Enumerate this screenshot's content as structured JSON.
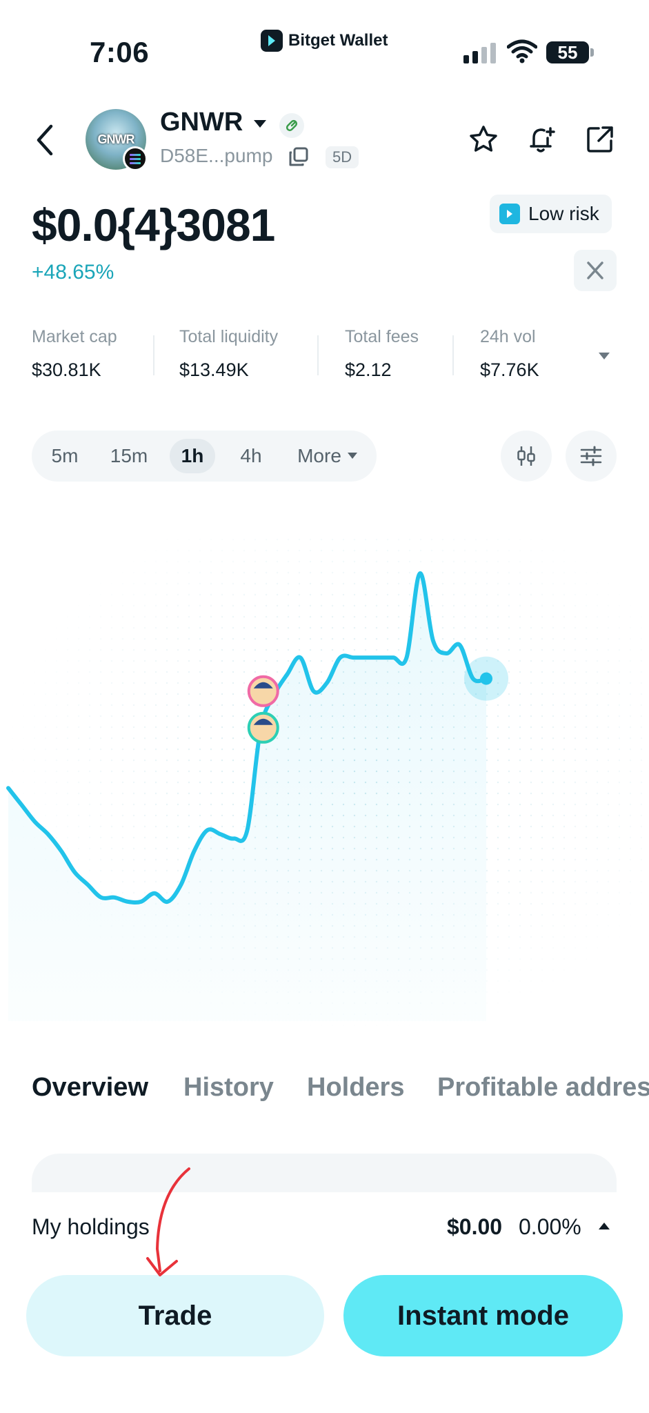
{
  "status_bar": {
    "time": "7:06",
    "battery": "55"
  },
  "brand": {
    "name": "Bitget Wallet"
  },
  "token": {
    "symbol": "GNWR",
    "avatar_text": "GNWR",
    "address": "D58E...pump",
    "age": "5D",
    "price": "$0.0{4}3081",
    "change": "+48.65%",
    "risk_label": "Low risk"
  },
  "stats": [
    {
      "label": "Market cap",
      "value": "$30.81K"
    },
    {
      "label": "Total liquidity",
      "value": "$13.49K"
    },
    {
      "label": "Total fees",
      "value": "$2.12"
    },
    {
      "label": "24h vol",
      "value": "$7.76K"
    }
  ],
  "intervals": [
    {
      "label": "5m",
      "active": false
    },
    {
      "label": "15m",
      "active": false
    },
    {
      "label": "1h",
      "active": true
    },
    {
      "label": "4h",
      "active": false
    },
    {
      "label": "More",
      "active": false
    }
  ],
  "chart_data": {
    "type": "line",
    "series": [
      {
        "values": [
          0.48,
          0.44,
          0.4,
          0.37,
          0.33,
          0.28,
          0.25,
          0.22,
          0.22,
          0.21,
          0.21,
          0.23,
          0.21,
          0.25,
          0.33,
          0.38,
          0.37,
          0.36,
          0.38,
          0.62,
          0.7,
          0.75,
          0.79,
          0.71,
          0.73,
          0.79,
          0.79,
          0.79,
          0.79,
          0.79,
          0.79,
          0.99,
          0.83,
          0.8,
          0.82,
          0.74,
          0.74
        ]
      }
    ],
    "line_color": "#22c3ea",
    "grid": false
  },
  "tabs": [
    "Overview",
    "History",
    "Holders",
    "Profitable addres"
  ],
  "holdings": {
    "label": "My holdings",
    "value": "$0.00",
    "percent": "0.00%"
  },
  "buttons": {
    "trade": "Trade",
    "instant": "Instant mode"
  },
  "colors": {
    "accent": "#22c3ea",
    "positive": "#1aa5b8",
    "annotation": "#e8323a"
  }
}
